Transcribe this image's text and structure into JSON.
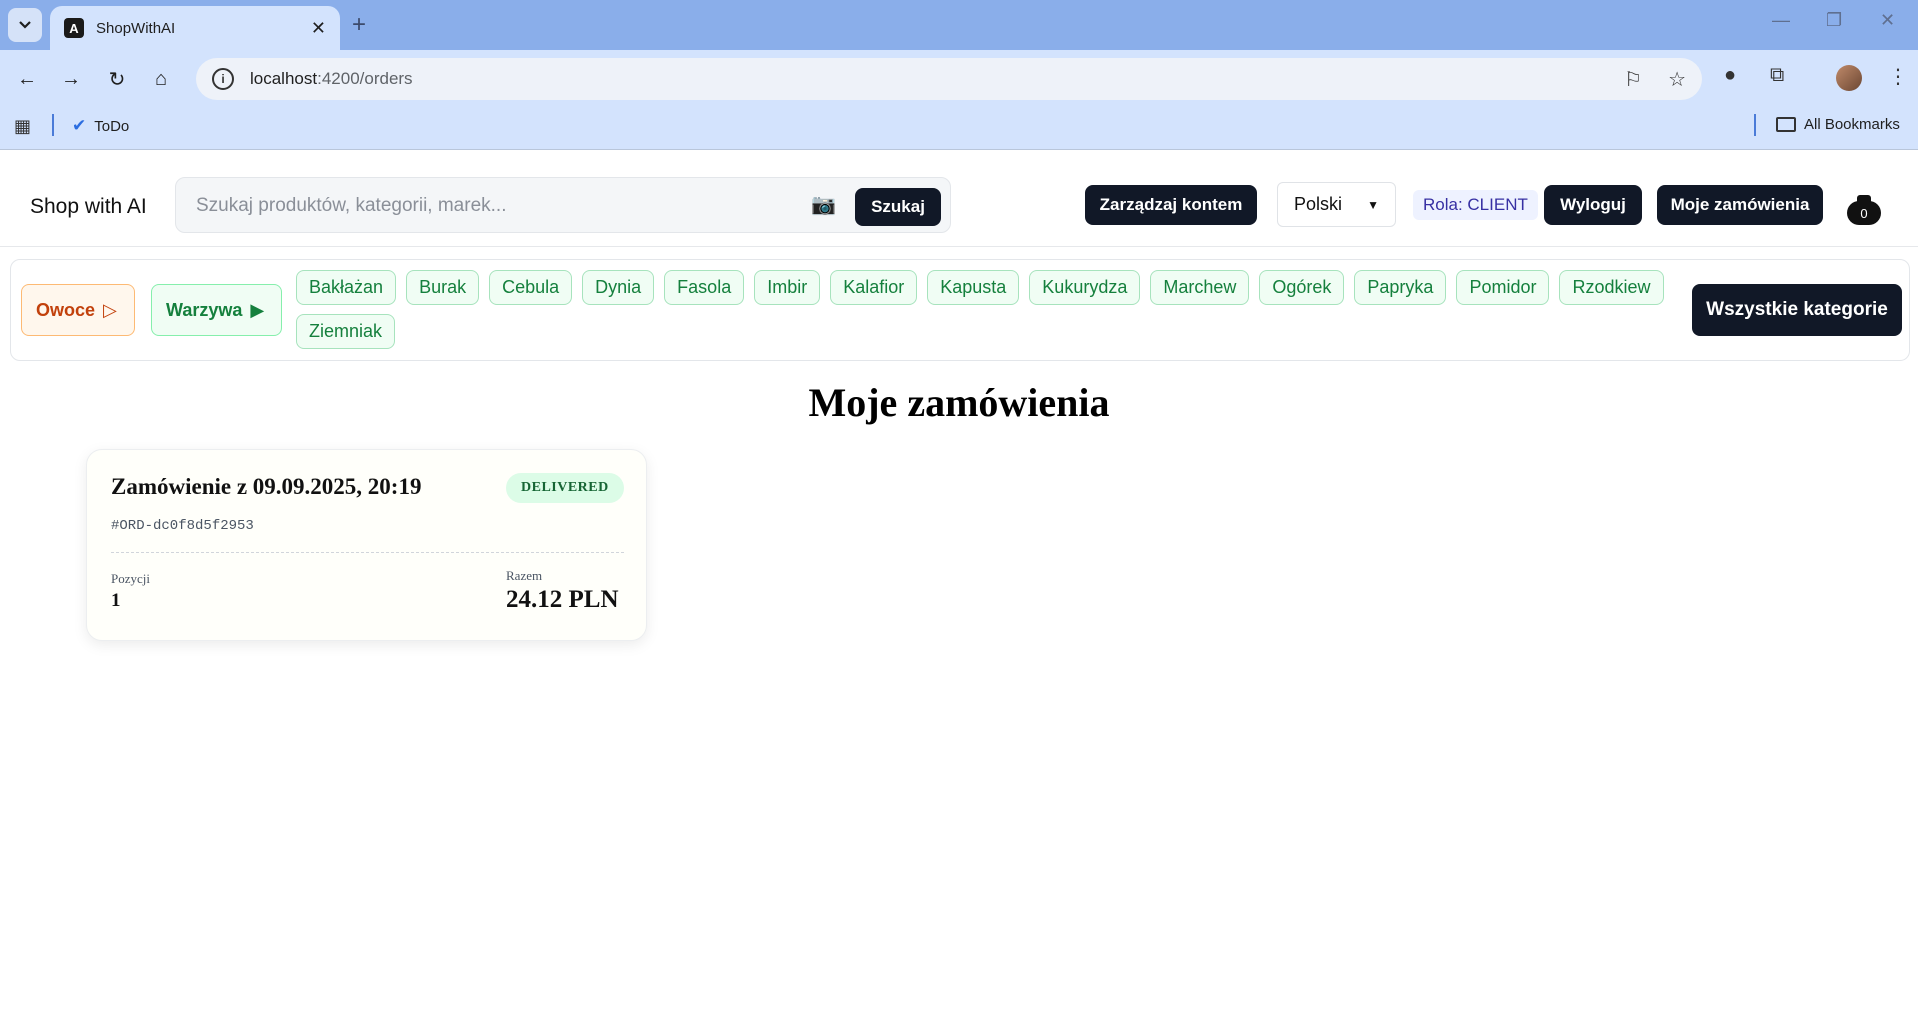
{
  "browser": {
    "tab_title": "ShopWithAI",
    "url_host": "localhost",
    "url_path": ":4200/orders",
    "bookmarks": [
      {
        "label": "ToDo"
      }
    ],
    "all_bookmarks_label": "All Bookmarks"
  },
  "header": {
    "brand": "Shop with AI",
    "search": {
      "placeholder": "Szukaj produktów, kategorii, marek...",
      "button_label": "Szukaj"
    },
    "manage_account_label": "Zarządzaj kontem",
    "language_selected": "Polski",
    "role_badge": "Rola: CLIENT",
    "logout_label": "Wyloguj",
    "my_orders_label": "Moje zamówienia",
    "cart_count": "0"
  },
  "categories": {
    "main": [
      {
        "label": "Owoce",
        "arrow": "▷"
      },
      {
        "label": "Warzywa",
        "arrow": "▶"
      }
    ],
    "sub": [
      "Bakłażan",
      "Burak",
      "Cebula",
      "Dynia",
      "Fasola",
      "Imbir",
      "Kalafior",
      "Kapusta",
      "Kukurydza",
      "Marchew",
      "Ogórek",
      "Papryka",
      "Pomidor",
      "Rzodkiew",
      "Ziemniak"
    ],
    "all_label": "Wszystkie kategorie"
  },
  "main": {
    "title": "Moje zamówienia",
    "orders": [
      {
        "title": "Zamówienie z 09.09.2025, 20:19",
        "status": "DELIVERED",
        "id": "#ORD-dc0f8d5f2953",
        "items_label": "Pozycji",
        "items_value": "1",
        "total_label": "Razem",
        "total_value": "24.12 PLN"
      }
    ]
  }
}
